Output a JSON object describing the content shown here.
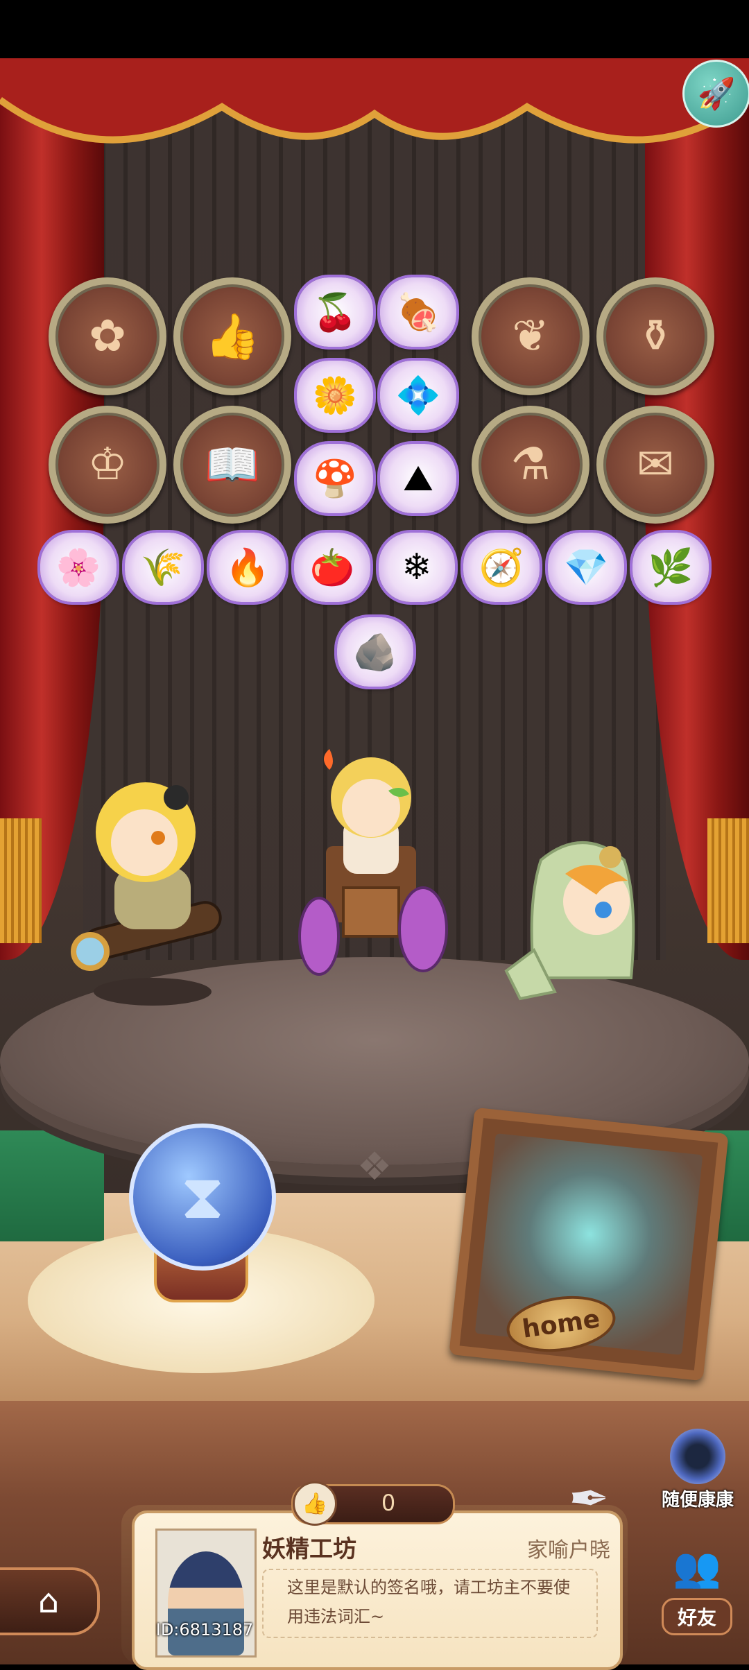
{
  "status_bar": {
    "background": "#000000"
  },
  "topbar": {
    "rocket_icon": "rocket-icon"
  },
  "badges": [
    {
      "icon": "crest-icon",
      "glyph": "✿"
    },
    {
      "icon": "thumb-icon",
      "glyph": "👍"
    },
    {
      "icon": "ornament-icon",
      "glyph": "❦"
    },
    {
      "icon": "cauldron-icon",
      "glyph": "⚱"
    },
    {
      "icon": "fairy-icon",
      "glyph": "♔"
    },
    {
      "icon": "book-icon",
      "glyph": "📖"
    },
    {
      "icon": "pot-icon",
      "glyph": "⚗"
    },
    {
      "icon": "scroll-icon",
      "glyph": "✉"
    }
  ],
  "items": [
    {
      "icon": "berries-icon",
      "glyph": "🍒"
    },
    {
      "icon": "meat-icon",
      "glyph": "🍖"
    },
    {
      "icon": "lily-icon",
      "glyph": "🌼"
    },
    {
      "icon": "blue-flower-icon",
      "glyph": "💠"
    },
    {
      "icon": "purple-mushroom-icon",
      "glyph": "🍄"
    },
    {
      "icon": "dirt-pile-icon",
      "glyph": "⛰"
    },
    {
      "icon": "white-flower-icon",
      "glyph": "🌸"
    },
    {
      "icon": "golden-grain-icon",
      "glyph": "🌾"
    },
    {
      "icon": "ore-icon",
      "glyph": "🔥"
    },
    {
      "icon": "tomato-icon",
      "glyph": "🍅"
    },
    {
      "icon": "salt-icon",
      "glyph": "❄"
    },
    {
      "icon": "compass-icon",
      "glyph": "🧭"
    },
    {
      "icon": "crystal-icon",
      "glyph": "💎"
    },
    {
      "icon": "herb-icon",
      "glyph": "🌿"
    },
    {
      "icon": "stone-shard-icon",
      "glyph": "🪨"
    }
  ],
  "characters": [
    {
      "name": "telescope-fairy"
    },
    {
      "name": "wheelchair-fairy"
    },
    {
      "name": "hooded-fairy"
    }
  ],
  "props": {
    "hourglass_icon": "hourglass-icon",
    "home_plate": "home"
  },
  "random_visit": {
    "label": "随便康康"
  },
  "likes": {
    "count": "0"
  },
  "profile": {
    "workshop_name": "妖精工坊",
    "owner": "家喻户晓",
    "signature": "这里是默认的签名哦，请工坊主不要使用违法词汇~",
    "user_id": "ID:6813187"
  },
  "nav": {
    "home_icon": "home-icon",
    "friends_label": "好友"
  },
  "colors": {
    "curtain_red": "#b32620",
    "fringe_gold": "#e4a233",
    "card_bg": "#fdf2dc"
  }
}
